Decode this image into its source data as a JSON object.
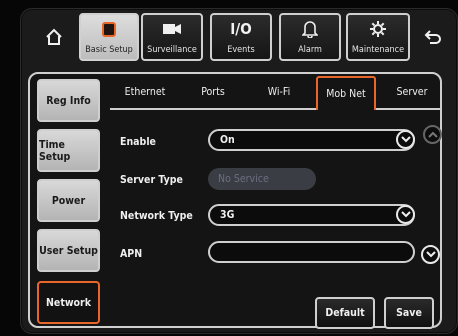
{
  "top_nav": {
    "home_icon": "home-icon",
    "back_icon": "back-arrow-icon",
    "tabs": [
      {
        "label": "Basic Setup",
        "icon": "document-icon"
      },
      {
        "label": "Surveillance",
        "icon": "camera-icon"
      },
      {
        "label": "Events",
        "icon": "io-icon",
        "icon_text": "I/O"
      },
      {
        "label": "Alarm",
        "icon": "bell-icon"
      },
      {
        "label": "Maintenance",
        "icon": "gear-icon"
      }
    ],
    "active_tab": "Basic Setup"
  },
  "sidebar": {
    "items": [
      {
        "label": "Reg Info"
      },
      {
        "label": "Time Setup"
      },
      {
        "label": "Power"
      },
      {
        "label": "User Setup"
      },
      {
        "label": "Network"
      }
    ],
    "active_item": "Network"
  },
  "sub_tabs": {
    "items": [
      "Ethernet",
      "Ports",
      "Wi-Fi",
      "Mob Net",
      "Server"
    ],
    "active": "Mob Net"
  },
  "form": {
    "enable": {
      "label": "Enable",
      "value": "On"
    },
    "server_type": {
      "label": "Server Type",
      "placeholder": "No Service"
    },
    "network_type": {
      "label": "Network Type",
      "value": "3G"
    },
    "apn": {
      "label": "APN",
      "value": ""
    }
  },
  "buttons": {
    "default_label": "Default",
    "save_label": "Save"
  },
  "colors": {
    "accent": "#e8662a",
    "border": "#cfcfcf",
    "background": "#141414"
  }
}
